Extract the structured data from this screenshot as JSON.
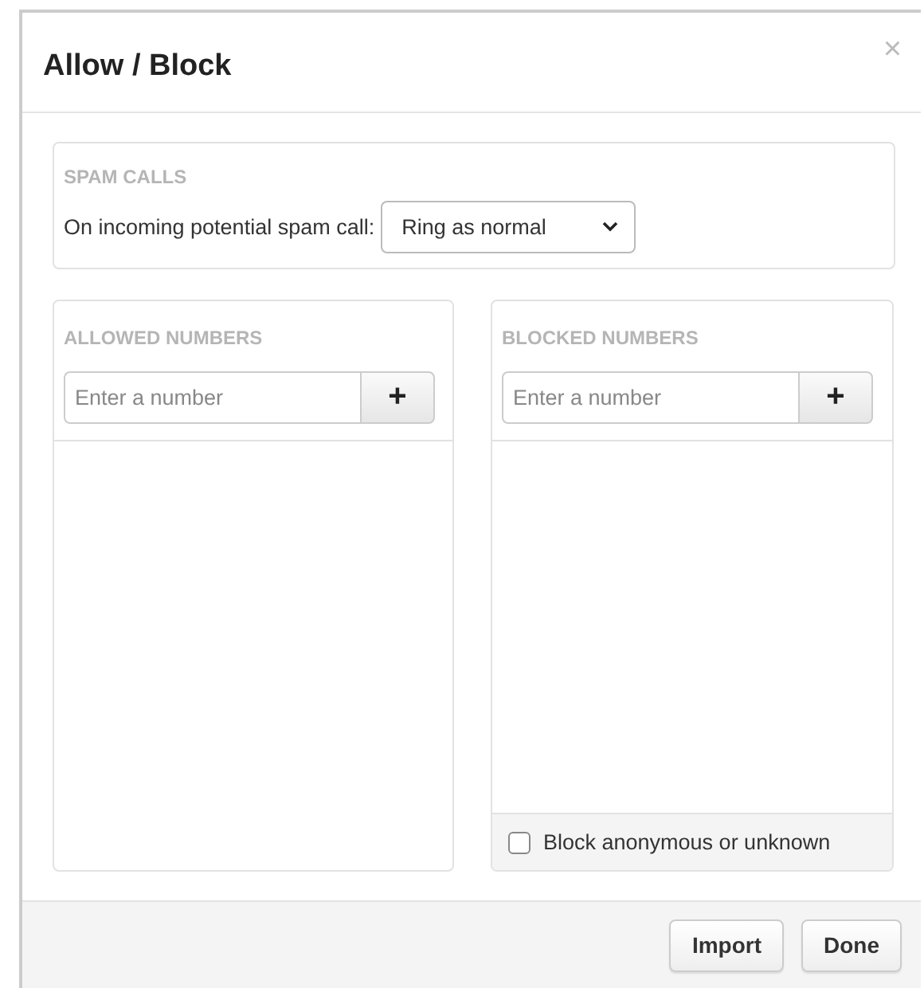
{
  "dialog": {
    "title": "Allow / Block",
    "close": "×"
  },
  "spam_calls": {
    "heading": "SPAM CALLS",
    "label": "On incoming potential spam call:",
    "select_value": "Ring as normal"
  },
  "lists": [
    {
      "heading": "ALLOWED NUMBERS",
      "placeholder": "Enter a number",
      "add": "+"
    },
    {
      "heading": "BLOCKED NUMBERS",
      "placeholder": "Enter a number",
      "add": "+",
      "option": {
        "label": "Block anonymous or unknown",
        "checked": false
      }
    }
  ],
  "buttons": [
    "Import",
    "Done"
  ]
}
